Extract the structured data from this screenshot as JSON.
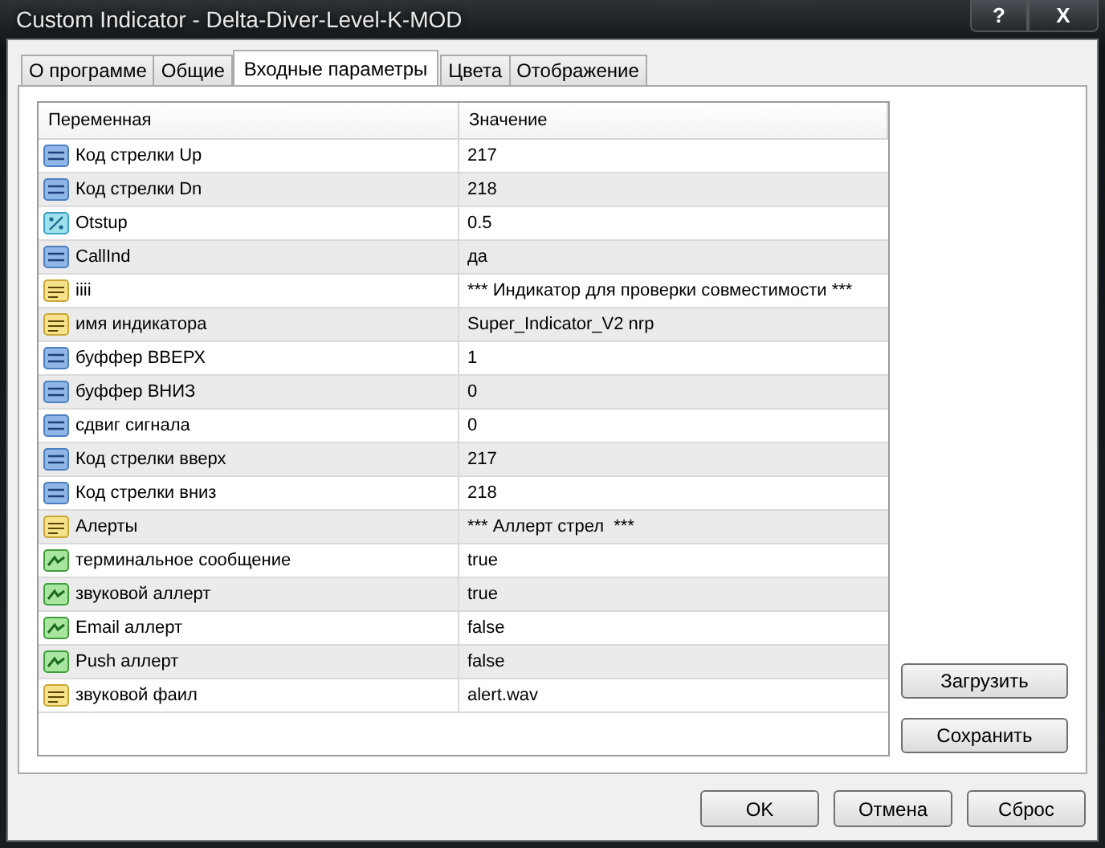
{
  "window": {
    "title": "Custom Indicator - Delta-Diver-Level-K-MOD",
    "help_button": "?",
    "close_button": "X"
  },
  "tabs": [
    {
      "label": "О программе",
      "selected": false
    },
    {
      "label": "Общие",
      "selected": false
    },
    {
      "label": "Входные параметры",
      "selected": true
    },
    {
      "label": "Цвета",
      "selected": false
    },
    {
      "label": "Отображение",
      "selected": false
    }
  ],
  "table": {
    "columns": [
      "Переменная",
      "Значение"
    ],
    "rows": [
      {
        "kind": "int",
        "variable": "Код стрелки Up",
        "value": "217"
      },
      {
        "kind": "int",
        "variable": "Код стрелки Dn",
        "value": "218"
      },
      {
        "kind": "double",
        "variable": "Otstup",
        "value": "0.5"
      },
      {
        "kind": "int",
        "variable": "CallInd",
        "value": "да"
      },
      {
        "kind": "string",
        "variable": "iiii",
        "value": "*** Индикатор для проверки совместимости ***"
      },
      {
        "kind": "string",
        "variable": "имя индикатора",
        "value": "Super_Indicator_V2 nrp"
      },
      {
        "kind": "int",
        "variable": "буффер ВВЕРХ",
        "value": "1"
      },
      {
        "kind": "int",
        "variable": "буффер ВНИЗ",
        "value": "0"
      },
      {
        "kind": "int",
        "variable": "сдвиг сигнала",
        "value": "0"
      },
      {
        "kind": "int",
        "variable": "Код стрелки вверх",
        "value": "217"
      },
      {
        "kind": "int",
        "variable": "Код стрелки вниз",
        "value": "218"
      },
      {
        "kind": "string",
        "variable": "Алерты",
        "value": "*** Аллерт стрел  ***"
      },
      {
        "kind": "bool",
        "variable": "терминальное сообщение",
        "value": "true"
      },
      {
        "kind": "bool",
        "variable": "звуковой аллерт",
        "value": "true"
      },
      {
        "kind": "bool",
        "variable": "Email аллерт",
        "value": "false"
      },
      {
        "kind": "bool",
        "variable": "Push аллерт",
        "value": "false"
      },
      {
        "kind": "string",
        "variable": "звуковой фаил",
        "value": "alert.wav"
      }
    ]
  },
  "side_buttons": [
    "Загрузить",
    "Сохранить"
  ],
  "buttons": [
    "OK",
    "Отмена",
    "Сброс"
  ]
}
